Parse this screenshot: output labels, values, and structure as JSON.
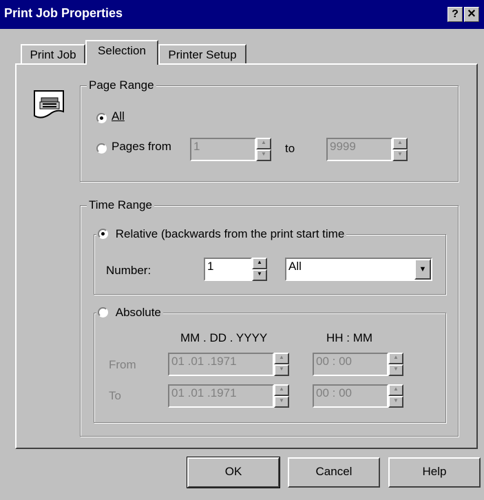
{
  "window": {
    "title": "Print Job Properties",
    "help_glyph": "?",
    "close_glyph": "✕"
  },
  "tabs": [
    {
      "label": "Print Job"
    },
    {
      "label": "Selection"
    },
    {
      "label": "Printer Setup"
    }
  ],
  "page_range": {
    "legend": "Page Range",
    "icon": "printer-icon",
    "all_label": "All",
    "all_selected": true,
    "pages_from_label": "Pages from",
    "from_value": "1",
    "to_label": "to",
    "to_value": "9999"
  },
  "time_range": {
    "legend": "Time Range",
    "relative": {
      "label": "Relative (backwards from the print start time",
      "selected": true,
      "number_label": "Number:",
      "number_value": "1",
      "unit_value": "All"
    },
    "absolute": {
      "label": "Absolute",
      "selected": false,
      "date_header": "MM . DD . YYYY",
      "time_header": "HH : MM",
      "from_label": "From",
      "to_label": "To",
      "from_date": "01 .01 .1971",
      "from_time": "00 : 00",
      "to_date": "01 .01 .1971",
      "to_time": "00 : 00"
    }
  },
  "buttons": {
    "ok": "OK",
    "cancel": "Cancel",
    "help": "Help"
  }
}
